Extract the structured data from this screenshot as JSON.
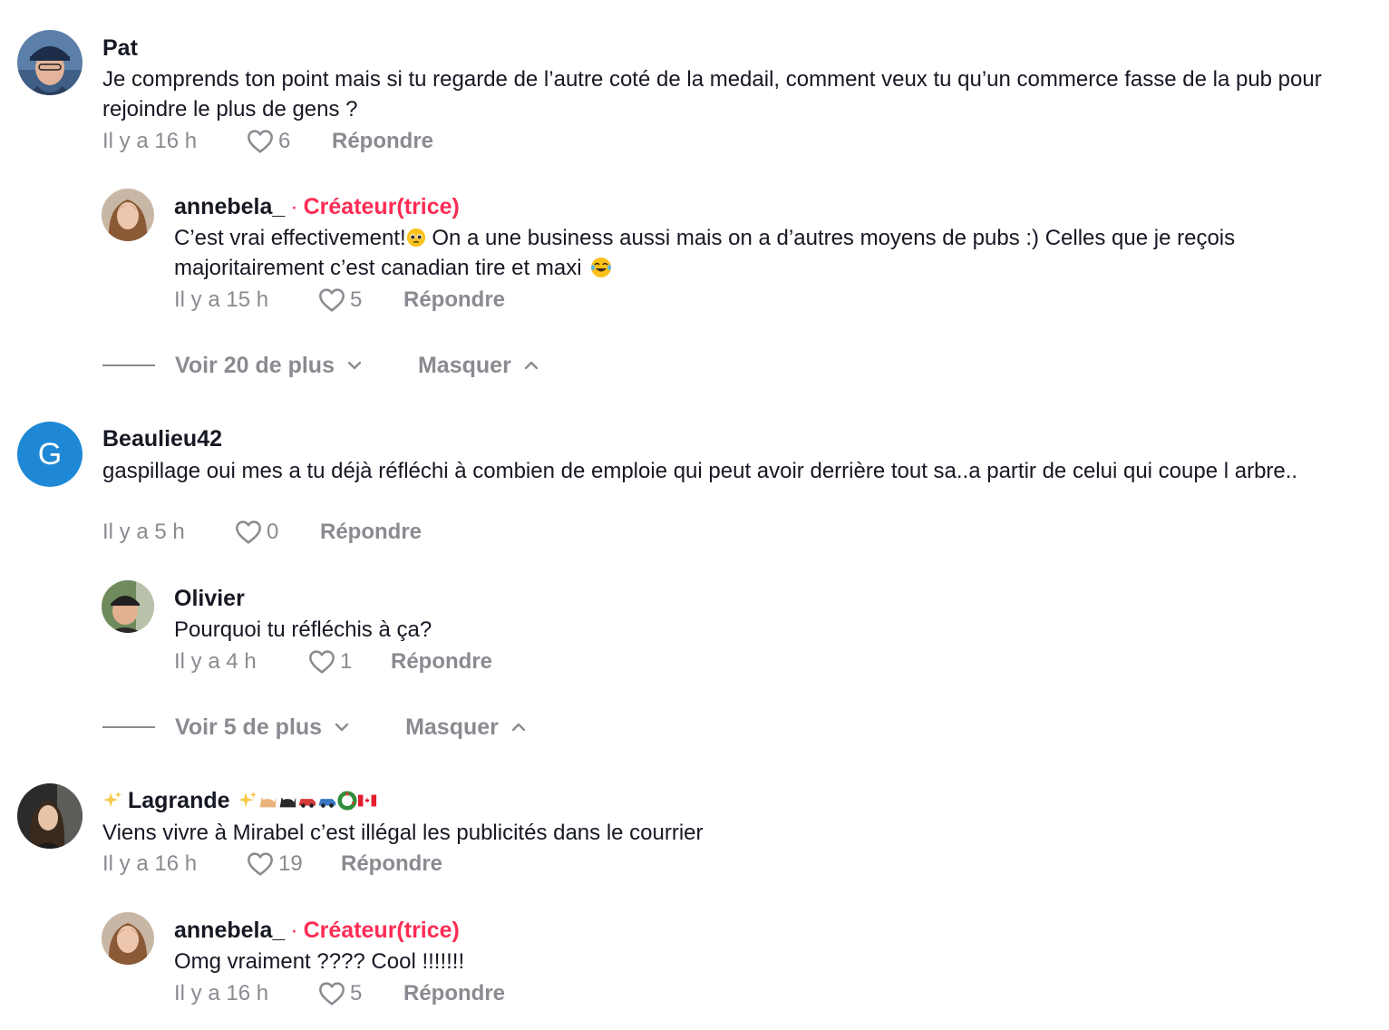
{
  "comments": [
    {
      "author": "Pat",
      "text": "Je comprends ton point mais si tu regarde de l’autre coté de la medail, comment veux tu qu’un commerce fasse de la pub pour rejoindre le plus de gens ?",
      "time": "Il y a 16 h",
      "likes": "6",
      "reply_label": "Répondre",
      "replies": [
        {
          "author": "annebela_",
          "badge_sep": "·",
          "badge": "Créateur(trice)",
          "text_part1": "C’est vrai effectivement!",
          "text_part2": " On a une business aussi mais on a d’autres moyens de pubs :) Celles que je reçois majoritairement c’est canadian tire et maxi ",
          "time": "Il y a 15 h",
          "likes": "5",
          "reply_label": "Répondre"
        }
      ],
      "more_label": "Voir 20 de plus",
      "hide_label": "Masquer"
    },
    {
      "author": "Beaulieu42",
      "avatar_letter": "G",
      "text": "gaspillage oui mes a tu déjà réfléchi à combien de emploie qui peut avoir derrière tout sa..a partir de celui qui coupe l arbre..",
      "time": "Il y a 5 h",
      "likes": "0",
      "reply_label": "Répondre",
      "replies": [
        {
          "author": "Olivier",
          "text": "Pourquoi tu réfléchis à ça?",
          "time": "Il y a 4 h",
          "likes": "1",
          "reply_label": "Répondre"
        }
      ],
      "more_label": "Voir 5 de plus",
      "hide_label": "Masquer"
    },
    {
      "author": "Lagrande",
      "text": "Viens vivre à Mirabel c’est illégal les publicités dans le courrier",
      "time": "Il y a 16 h",
      "likes": "19",
      "reply_label": "Répondre",
      "replies": [
        {
          "author": "annebela_",
          "badge_sep": "·",
          "badge": "Créateur(trice)",
          "text": "Omg vraiment ???? Cool !!!!!!!",
          "time": "Il y a 16 h",
          "likes": "5",
          "reply_label": "Répondre"
        }
      ]
    }
  ],
  "colors": {
    "creator_badge": "#fe2c55",
    "meta_gray": "#8a8b91",
    "avatar_letter_bg": "#1e88d6"
  },
  "icons": [
    "heart-outline-icon",
    "chevron-down-icon",
    "chevron-up-icon",
    "sparkles-icon",
    "cat-icon",
    "car-icon",
    "wreath-icon",
    "canada-flag-icon",
    "pleading-face-icon",
    "tears-of-joy-icon"
  ]
}
